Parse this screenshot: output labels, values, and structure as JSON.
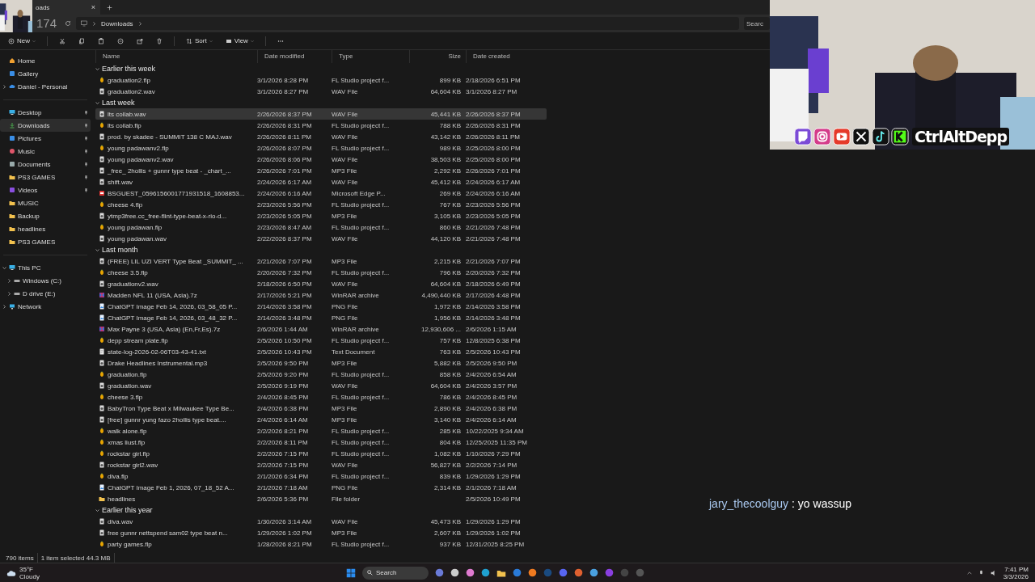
{
  "tab": {
    "title": "oads",
    "close": "×"
  },
  "overlay_number": "174",
  "breadcrumb": [
    "Downloads"
  ],
  "search": {
    "placeholder": "Searc"
  },
  "commands": [
    {
      "kind": "new",
      "label": "New"
    },
    {
      "kind": "cut"
    },
    {
      "kind": "copy"
    },
    {
      "kind": "paste"
    },
    {
      "kind": "rename"
    },
    {
      "kind": "share"
    },
    {
      "kind": "delete"
    },
    {
      "kind": "sort",
      "label": "Sort"
    },
    {
      "kind": "view",
      "label": "View"
    },
    {
      "kind": "more"
    }
  ],
  "nav": [
    [
      {
        "kind": "home",
        "label": "Home",
        "selected": false,
        "pinned": false
      },
      {
        "kind": "gallery",
        "label": "Gallery",
        "selected": false,
        "pinned": false
      },
      {
        "kind": "cloud",
        "label": "Daniel - Personal",
        "selected": false,
        "pinned": false,
        "expanded": false
      }
    ],
    [
      {
        "kind": "desktop",
        "label": "Desktop",
        "selected": false,
        "pinned": true
      },
      {
        "kind": "downloads",
        "label": "Downloads",
        "selected": true,
        "pinned": true
      },
      {
        "kind": "pictures",
        "label": "Pictures",
        "selected": false,
        "pinned": true
      },
      {
        "kind": "music",
        "label": "Music",
        "selected": false,
        "pinned": true
      },
      {
        "kind": "documents",
        "label": "Documents",
        "selected": false,
        "pinned": true
      },
      {
        "kind": "folder",
        "label": "PS3 GAMES",
        "selected": false,
        "pinned": true
      },
      {
        "kind": "videos",
        "label": "Videos",
        "selected": false,
        "pinned": true
      },
      {
        "kind": "folder",
        "label": "MUSIC",
        "selected": false,
        "pinned": false
      },
      {
        "kind": "folder",
        "label": "Backup",
        "selected": false,
        "pinned": false
      },
      {
        "kind": "folder",
        "label": "headlines",
        "selected": false,
        "pinned": false
      },
      {
        "kind": "folder",
        "label": "PS3 GAMES",
        "selected": false,
        "pinned": false
      }
    ],
    [
      {
        "kind": "pc",
        "label": "This PC",
        "selected": false,
        "pinned": false,
        "expanded": true,
        "children": [
          {
            "kind": "drive",
            "label": "Windows (C:)",
            "selected": false,
            "pinned": false,
            "expanded": false
          },
          {
            "kind": "drive",
            "label": "D drive (E:)",
            "selected": false,
            "pinned": false,
            "expanded": false
          }
        ]
      },
      {
        "kind": "network",
        "label": "Network",
        "selected": false,
        "pinned": false,
        "expanded": false
      }
    ]
  ],
  "columns": [
    {
      "label": "Name"
    },
    {
      "label": "Date modified"
    },
    {
      "label": "Type"
    },
    {
      "label": "Size"
    },
    {
      "label": "Date created"
    }
  ],
  "groups": [
    {
      "label": "Earlier this week",
      "expanded": true,
      "rows": [
        {
          "kind": "flp",
          "name": "graduation2.flp",
          "modified": "3/1/2026 8:28 PM",
          "type": "FL Studio project f...",
          "size": "899 KB",
          "created": "2/18/2026 6:51 PM",
          "selected": false
        },
        {
          "kind": "wav",
          "name": "graduation2.wav",
          "modified": "3/1/2026 8:27 PM",
          "type": "WAV File",
          "size": "64,604 KB",
          "created": "3/1/2026 8:27 PM",
          "selected": false
        }
      ]
    },
    {
      "label": "Last week",
      "expanded": true,
      "rows": [
        {
          "kind": "wav",
          "name": "lts collab.wav",
          "modified": "2/26/2026 8:37 PM",
          "type": "WAV File",
          "size": "45,441 KB",
          "created": "2/26/2026 8:37 PM",
          "selected": true
        },
        {
          "kind": "flp",
          "name": "lts collab.flp",
          "modified": "2/26/2026 8:31 PM",
          "type": "FL Studio project f...",
          "size": "788 KB",
          "created": "2/26/2026 8:31 PM",
          "selected": false
        },
        {
          "kind": "wav",
          "name": "prod. by skadee - SUMMIT 138 C MAJ.wav",
          "modified": "2/26/2026 8:11 PM",
          "type": "WAV File",
          "size": "43,142 KB",
          "created": "2/26/2026 8:11 PM",
          "selected": false
        },
        {
          "kind": "flp",
          "name": "young padawanv2.flp",
          "modified": "2/26/2026 8:07 PM",
          "type": "FL Studio project f...",
          "size": "989 KB",
          "created": "2/25/2026 8:00 PM",
          "selected": false
        },
        {
          "kind": "wav",
          "name": "young padawanv2.wav",
          "modified": "2/26/2026 8:06 PM",
          "type": "WAV File",
          "size": "38,503 KB",
          "created": "2/25/2026 8:00 PM",
          "selected": false
        },
        {
          "kind": "mp3",
          "name": "_free_ 2hollis + gunnr type beat - _chart_...",
          "modified": "2/26/2026 7:01 PM",
          "type": "MP3 File",
          "size": "2,292 KB",
          "created": "2/26/2026 7:01 PM",
          "selected": false
        },
        {
          "kind": "wav",
          "name": "shift.wav",
          "modified": "2/24/2026 6:17 AM",
          "type": "WAV File",
          "size": "45,412 KB",
          "created": "2/24/2026 6:17 AM",
          "selected": false
        },
        {
          "kind": "pdf",
          "name": "BSGUEST_0596156001771931518_1608853...",
          "modified": "2/24/2026 6:16 AM",
          "type": "Microsoft Edge P...",
          "size": "269 KB",
          "created": "2/24/2026 6:16 AM",
          "selected": false
        },
        {
          "kind": "flp",
          "name": "cheese 4.flp",
          "modified": "2/23/2026 5:56 PM",
          "type": "FL Studio project f...",
          "size": "767 KB",
          "created": "2/23/2026 5:56 PM",
          "selected": false
        },
        {
          "kind": "mp3",
          "name": "ytmp3free.cc_free-flint-type-beat-x-rio-d...",
          "modified": "2/23/2026 5:05 PM",
          "type": "MP3 File",
          "size": "3,105 KB",
          "created": "2/23/2026 5:05 PM",
          "selected": false
        },
        {
          "kind": "flp",
          "name": "young padawan.flp",
          "modified": "2/23/2026 8:47 AM",
          "type": "FL Studio project f...",
          "size": "860 KB",
          "created": "2/21/2026 7:48 PM",
          "selected": false
        },
        {
          "kind": "wav",
          "name": "young padawan.wav",
          "modified": "2/22/2026 8:37 PM",
          "type": "WAV File",
          "size": "44,120 KB",
          "created": "2/21/2026 7:48 PM",
          "selected": false
        }
      ]
    },
    {
      "label": "Last month",
      "expanded": true,
      "rows": [
        {
          "kind": "mp3",
          "name": "(FREE) LIL UZI VERT Type Beat _SUMMIT_ ...",
          "modified": "2/21/2026 7:07 PM",
          "type": "MP3 File",
          "size": "2,215 KB",
          "created": "2/21/2026 7:07 PM",
          "selected": false
        },
        {
          "kind": "flp",
          "name": "cheese 3.5.flp",
          "modified": "2/20/2026 7:32 PM",
          "type": "FL Studio project f...",
          "size": "796 KB",
          "created": "2/20/2026 7:32 PM",
          "selected": false
        },
        {
          "kind": "wav",
          "name": "graduationv2.wav",
          "modified": "2/18/2026 6:50 PM",
          "type": "WAV File",
          "size": "64,604 KB",
          "created": "2/18/2026 6:49 PM",
          "selected": false
        },
        {
          "kind": "rar",
          "name": "Madden NFL 11 (USA, Asia).7z",
          "modified": "2/17/2026 5:21 PM",
          "type": "WinRAR archive",
          "size": "4,490,440 KB",
          "created": "2/17/2026 4:48 PM",
          "selected": false
        },
        {
          "kind": "png",
          "name": "ChatGPT Image Feb 14, 2026, 03_58_05 P...",
          "modified": "2/14/2026 3:58 PM",
          "type": "PNG File",
          "size": "1,972 KB",
          "created": "2/14/2026 3:58 PM",
          "selected": false
        },
        {
          "kind": "png",
          "name": "ChatGPT Image Feb 14, 2026, 03_48_32 P...",
          "modified": "2/14/2026 3:48 PM",
          "type": "PNG File",
          "size": "1,956 KB",
          "created": "2/14/2026 3:48 PM",
          "selected": false
        },
        {
          "kind": "rar",
          "name": "Max Payne 3 (USA, Asia) (En,Fr,Es).7z",
          "modified": "2/6/2026 1:44 AM",
          "type": "WinRAR archive",
          "size": "12,930,606 ...",
          "created": "2/6/2026 1:15 AM",
          "selected": false
        },
        {
          "kind": "flp",
          "name": "depp stream plate.flp",
          "modified": "2/5/2026 10:50 PM",
          "type": "FL Studio project f...",
          "size": "757 KB",
          "created": "12/8/2025 6:38 PM",
          "selected": false
        },
        {
          "kind": "txt",
          "name": "state-log-2026-02-06T03-43-41.txt",
          "modified": "2/5/2026 10:43 PM",
          "type": "Text Document",
          "size": "763 KB",
          "created": "2/5/2026 10:43 PM",
          "selected": false
        },
        {
          "kind": "mp3",
          "name": "Drake  Headlines Instrumental.mp3",
          "modified": "2/5/2026 9:50 PM",
          "type": "MP3 File",
          "size": "5,882 KB",
          "created": "2/5/2026 9:50 PM",
          "selected": false
        },
        {
          "kind": "flp",
          "name": "graduation.flp",
          "modified": "2/5/2026 9:20 PM",
          "type": "FL Studio project f...",
          "size": "858 KB",
          "created": "2/4/2026 6:54 AM",
          "selected": false
        },
        {
          "kind": "wav",
          "name": "graduation.wav",
          "modified": "2/5/2026 9:19 PM",
          "type": "WAV File",
          "size": "64,604 KB",
          "created": "2/4/2026 3:57 PM",
          "selected": false
        },
        {
          "kind": "flp",
          "name": "cheese 3.flp",
          "modified": "2/4/2026 8:45 PM",
          "type": "FL Studio project f...",
          "size": "786 KB",
          "created": "2/4/2026 8:45 PM",
          "selected": false
        },
        {
          "kind": "mp3",
          "name": "BabyTron Type Beat x Milwaukee Type Be...",
          "modified": "2/4/2026 6:38 PM",
          "type": "MP3 File",
          "size": "2,890 KB",
          "created": "2/4/2026 6:38 PM",
          "selected": false
        },
        {
          "kind": "mp3",
          "name": "[free] gunnr  yung fazo  2hollis type beat....",
          "modified": "2/4/2026 6:14 AM",
          "type": "MP3 File",
          "size": "3,140 KB",
          "created": "2/4/2026 6:14 AM",
          "selected": false
        },
        {
          "kind": "flp",
          "name": "walk alone.flp",
          "modified": "2/2/2026 8:21 PM",
          "type": "FL Studio project f...",
          "size": "285 KB",
          "created": "10/22/2025 9:34 AM",
          "selected": false
        },
        {
          "kind": "flp",
          "name": "xmas liust.flp",
          "modified": "2/2/2026 8:11 PM",
          "type": "FL Studio project f...",
          "size": "804 KB",
          "created": "12/25/2025 11:35 PM",
          "selected": false
        },
        {
          "kind": "flp",
          "name": "rockstar girl.flp",
          "modified": "2/2/2026 7:15 PM",
          "type": "FL Studio project f...",
          "size": "1,082 KB",
          "created": "1/10/2026 7:29 PM",
          "selected": false
        },
        {
          "kind": "wav",
          "name": "rockstar girl2.wav",
          "modified": "2/2/2026 7:15 PM",
          "type": "WAV File",
          "size": "56,827 KB",
          "created": "2/2/2026 7:14 PM",
          "selected": false
        },
        {
          "kind": "flp",
          "name": "diva.flp",
          "modified": "2/1/2026 6:34 PM",
          "type": "FL Studio project f...",
          "size": "839 KB",
          "created": "1/29/2026 1:29 PM",
          "selected": false
        },
        {
          "kind": "png",
          "name": "ChatGPT Image Feb 1, 2026, 07_18_52 A...",
          "modified": "2/1/2026 7:18 AM",
          "type": "PNG File",
          "size": "2,314 KB",
          "created": "2/1/2026 7:18 AM",
          "selected": false
        },
        {
          "kind": "folder",
          "name": "headlines",
          "modified": "2/6/2026 5:36 PM",
          "type": "File folder",
          "created": "2/5/2026 10:49 PM",
          "selected": false
        }
      ]
    },
    {
      "label": "Earlier this year",
      "expanded": true,
      "rows": [
        {
          "kind": "wav",
          "name": "diva.wav",
          "modified": "1/30/2026 3:14 AM",
          "type": "WAV File",
          "size": "45,473 KB",
          "created": "1/29/2026 1:29 PM",
          "selected": false
        },
        {
          "kind": "mp3",
          "name": "free gunnr  nettspend  sam02 type beat n...",
          "modified": "1/29/2026 1:02 PM",
          "type": "MP3 File",
          "size": "2,607 KB",
          "created": "1/29/2026 1:02 PM",
          "selected": false
        },
        {
          "kind": "flp",
          "name": "party games.flp",
          "modified": "1/28/2026 8:21 PM",
          "type": "FL Studio project f...",
          "size": "937 KB",
          "created": "12/31/2025 8:25 PM",
          "selected": false
        }
      ]
    }
  ],
  "status": {
    "items": "790 items",
    "selection": "1 item selected  44.3 MB"
  },
  "taskbar": {
    "weather": {
      "temp": "35°F",
      "condition": "Cloudy"
    },
    "search": "Search",
    "time": "7:41 PM",
    "date": "3/3/2026"
  },
  "stream": {
    "channel": "CtrlAltDepp",
    "chat": {
      "user": "jary_thecoolguy",
      "message": ": yo wassup"
    }
  }
}
